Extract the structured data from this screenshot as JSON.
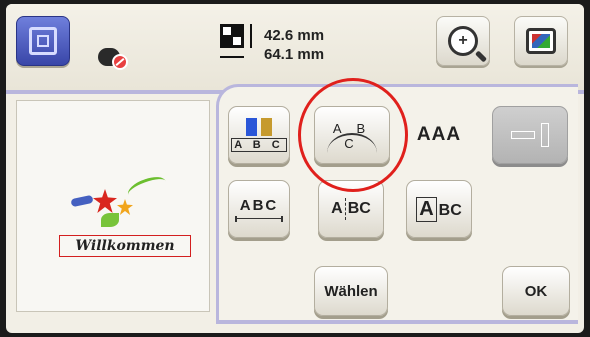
{
  "toolbar": {
    "hoop_frame_icon": "frame-center-icon",
    "thread_status_icon": "thread-disabled-icon",
    "size_icon": "dimensions-icon",
    "width_value": "42.6 mm",
    "height_value": "64.1 mm",
    "zoom_icon": "zoom-in-icon",
    "hoop_view_icon": "embroidery-hoop-icon"
  },
  "preview": {
    "design_text": "Willkommen"
  },
  "edit_buttons": {
    "thread_colors_text": "A B C",
    "arc_text": "A B C",
    "font_text": "AAA",
    "width_text": "ABC",
    "spacing_left": "A",
    "spacing_right": "BC",
    "size_big": "A",
    "size_rest": "BC"
  },
  "actions": {
    "select_label": "Wählen",
    "ok_label": "OK"
  },
  "colors": {
    "accent_active": "#3946a8",
    "panel_border": "#b9b6dd",
    "highlight": "#e0201c"
  }
}
